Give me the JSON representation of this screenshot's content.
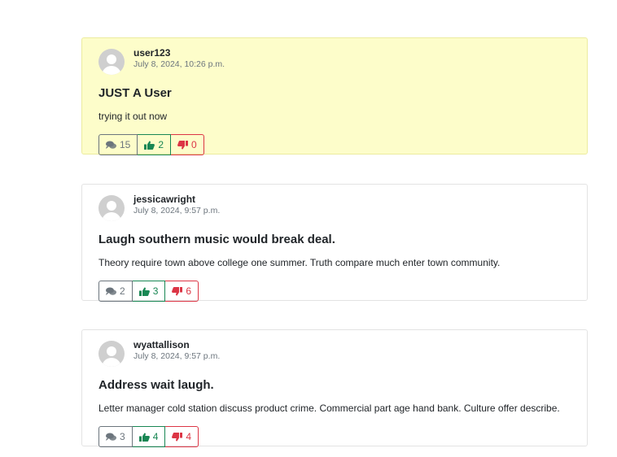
{
  "posts": [
    {
      "username": "user123",
      "date": "July 8, 2024, 10:26 p.m.",
      "title": "JUST A User",
      "body": "trying it out now",
      "comments": "15",
      "likes": "2",
      "dislikes": "0",
      "highlight": true
    },
    {
      "username": "jessicawright",
      "date": "July 8, 2024, 9:57 p.m.",
      "title": "Laugh southern music would break deal.",
      "body": "Theory require town above college one summer. Truth compare much enter town community.",
      "comments": "2",
      "likes": "3",
      "dislikes": "6",
      "highlight": false
    },
    {
      "username": "wyattallison",
      "date": "July 8, 2024, 9:57 p.m.",
      "title": "Address wait laugh.",
      "body": "Letter manager cold station discuss product crime. Commercial part age hand bank. Culture offer describe.",
      "comments": "3",
      "likes": "4",
      "dislikes": "4",
      "highlight": false
    }
  ],
  "colors": {
    "highlight_bg": "#fdfdca",
    "like": "#198754",
    "dislike": "#dc3545",
    "comment": "#6c757d"
  },
  "icons": {
    "comment": "comments-icon",
    "like": "thumbs-up-icon",
    "dislike": "thumbs-down-icon"
  }
}
